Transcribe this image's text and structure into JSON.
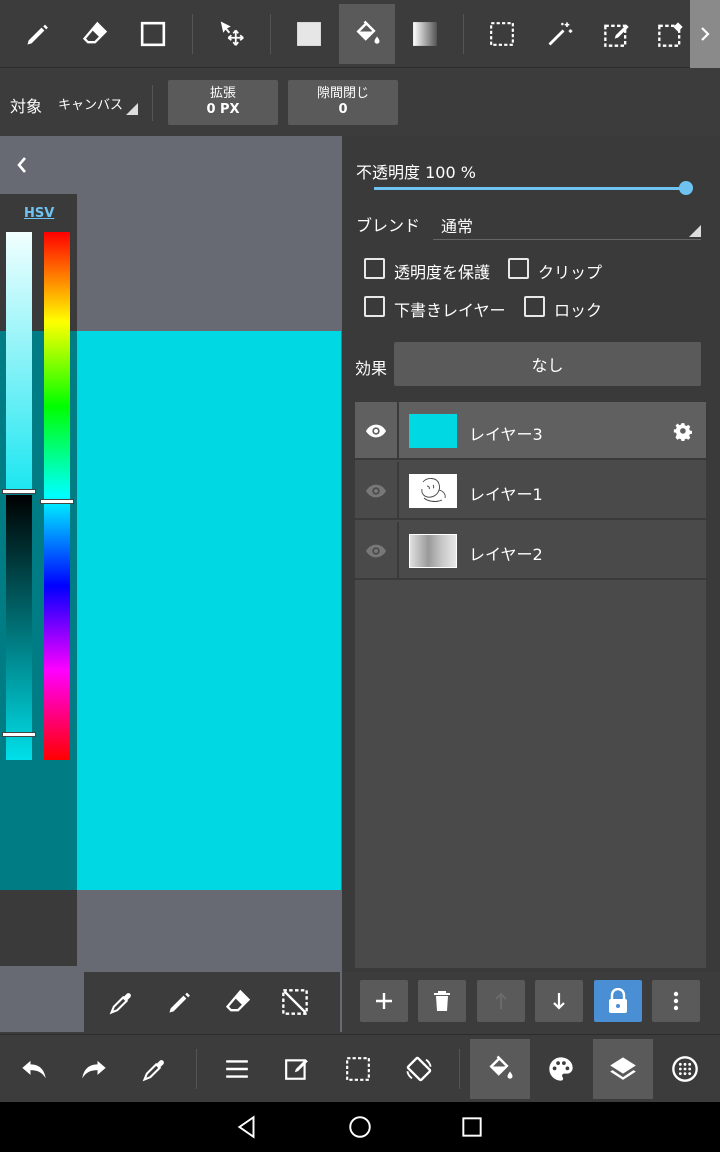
{
  "toolbar": {
    "tools": [
      "pen-icon",
      "eraser-icon",
      "rectangle-icon",
      "move-icon",
      "fill-color-icon",
      "bucket-fill-icon",
      "gradient-icon",
      "select-rect-icon",
      "magic-wand-icon",
      "select-pen-icon",
      "select-eraser-icon"
    ],
    "active_tool": "bucket-fill-icon"
  },
  "options": {
    "target_label": "対象",
    "target_value": "キャンバス",
    "expand_label": "拡張",
    "expand_value": "0 PX",
    "gap_label": "隙間閉じ",
    "gap_value": "0"
  },
  "color_panel": {
    "mode_label": "HSV",
    "value_level": 0.49,
    "hue_level": 0.51,
    "saturation_level": 0.95
  },
  "layer_props": {
    "opacity_label": "不透明度 100 %",
    "opacity_value": 1.0,
    "blend_label": "ブレンド",
    "blend_value": "通常",
    "protect_alpha_label": "透明度を保護",
    "clip_label": "クリップ",
    "draft_label": "下書きレイヤー",
    "lock_label": "ロック",
    "effect_label": "効果",
    "effect_value": "なし"
  },
  "layers": [
    {
      "name": "レイヤー3",
      "selected": true,
      "thumb": "cyan"
    },
    {
      "name": "レイヤー1",
      "selected": false,
      "thumb": "sketch"
    },
    {
      "name": "レイヤー2",
      "selected": false,
      "thumb": "gray"
    }
  ],
  "colors": {
    "canvas_fill": "#00d8e4",
    "accent": "#6fc3f0",
    "lock_active": "#4a8fd4"
  }
}
